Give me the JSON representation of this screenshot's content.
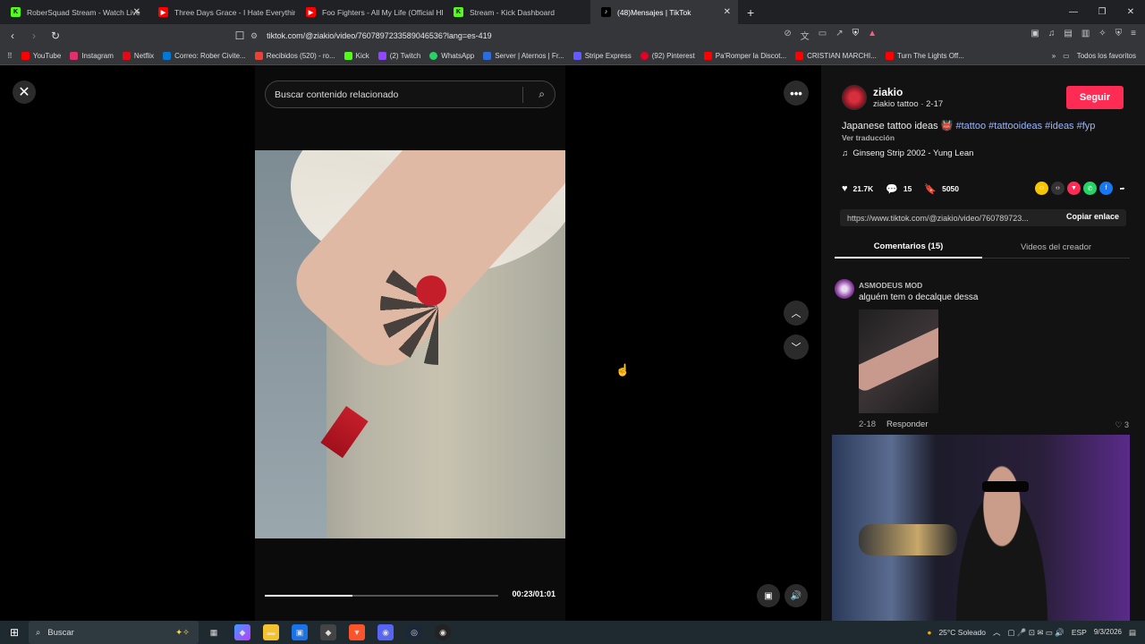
{
  "tabs": [
    {
      "label": "RoberSquad Stream - Watch Live",
      "color": "#53fc18",
      "glyph": "K"
    },
    {
      "label": "Three Days Grace - I Hate Everything",
      "color": "#ff0000",
      "glyph": "▶"
    },
    {
      "label": "Foo Fighters - All My Life (Official HD",
      "color": "#ff0000",
      "glyph": "▶"
    },
    {
      "label": "Stream - Kick Dashboard",
      "color": "#53fc18",
      "glyph": "K"
    },
    {
      "label": "(48)Mensajes | TikTok",
      "color": "#ffffff",
      "glyph": "♪"
    }
  ],
  "url": "tiktok.com/@ziakio/video/7607897233589046536?lang=es-419",
  "bookmarks": [
    {
      "label": "YouTube",
      "color": "#ff0000"
    },
    {
      "label": "Instagram",
      "color": "#e1306c"
    },
    {
      "label": "Netflix",
      "color": "#e50914"
    },
    {
      "label": "Correo: Rober Civite...",
      "color": "#0078d4"
    },
    {
      "label": "Recibidos (520) - ro...",
      "color": "#ea4335"
    },
    {
      "label": "Kick",
      "color": "#53fc18"
    },
    {
      "label": "(2) Twitch",
      "color": "#9146ff"
    },
    {
      "label": "WhatsApp",
      "color": "#25d366"
    },
    {
      "label": "Server | Aternos | Fr...",
      "color": "#2d6cdf"
    },
    {
      "label": "Stripe Express",
      "color": "#635bff"
    },
    {
      "label": "(92) Pinterest",
      "color": "#e60023"
    },
    {
      "label": "Pa'Romper la Discot...",
      "color": "#ff0000"
    },
    {
      "label": "CRISTIAN MARCHI...",
      "color": "#ff0000"
    },
    {
      "label": "Turn The Lights Off...",
      "color": "#ff0000"
    }
  ],
  "bookmarks_all": "Todos los favoritos",
  "search": {
    "placeholder": "Buscar contenido relacionado"
  },
  "player": {
    "time": "00:23/01:01",
    "progress": 0.3767
  },
  "creator": {
    "name": "ziakio",
    "sub": "ziakio tattoo · 2-17",
    "follow": "Seguir"
  },
  "description": {
    "text": "Japanese tattoo ideas 👹 ",
    "tags": "#tattoo #tattooideas #ideas #fyp",
    "translate": "Ver traducción"
  },
  "music": "Ginseng Strip 2002 - Yung Lean",
  "stats": {
    "likes": "21.7K",
    "comments": "15",
    "saves": "5050"
  },
  "link": {
    "url": "https://www.tiktok.com/@ziakio/video/760789723...",
    "copy": "Copiar enlace"
  },
  "panel_tabs": {
    "comments": "Comentarios (15)",
    "creator_videos": "Videos del creador"
  },
  "comment": {
    "author": "ASMODEUS MOD",
    "text": "alguém tem o decalque dessa",
    "date": "2-18",
    "reply": "Responder",
    "likes": "3"
  },
  "taskbar": {
    "search": "Buscar",
    "weather": "25°C Soleado",
    "lang": "ESP",
    "date": "9/3/2026"
  }
}
